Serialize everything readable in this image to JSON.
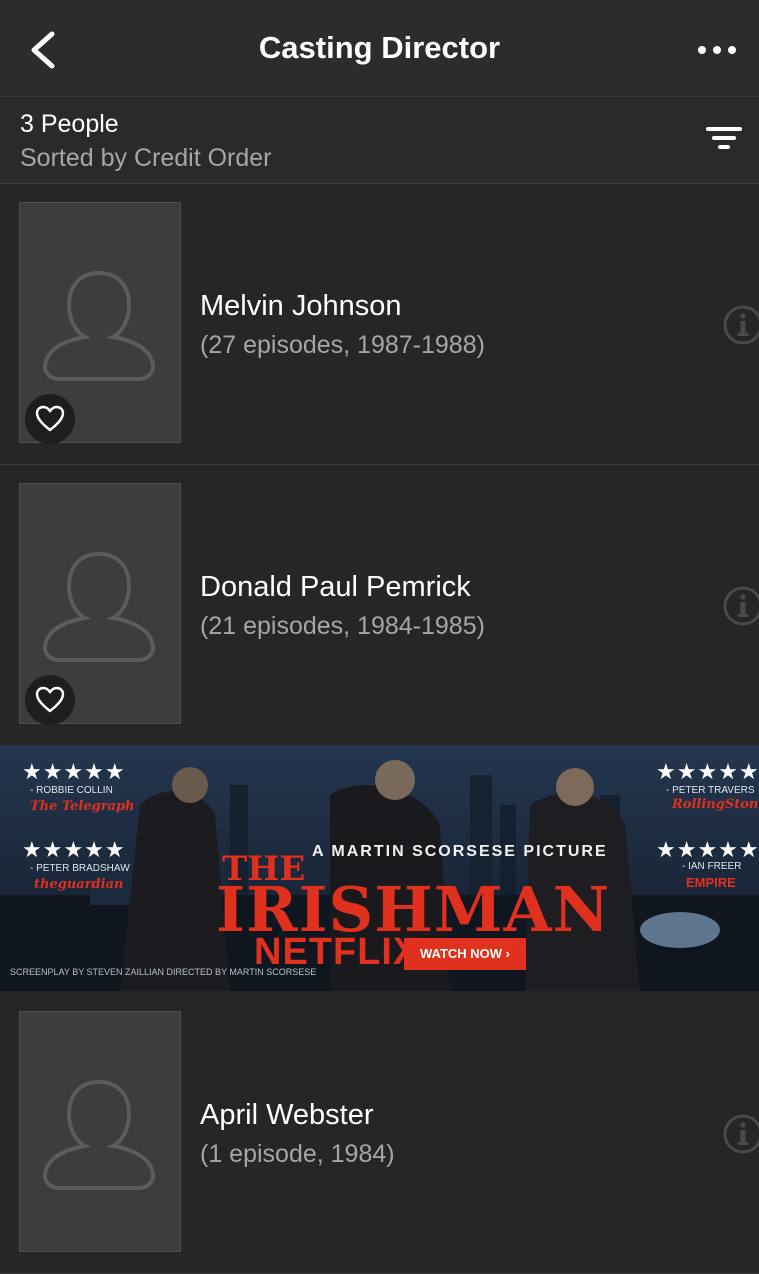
{
  "header": {
    "title": "Casting Director"
  },
  "summary": {
    "count": "3 People",
    "sort": "Sorted by Credit Order"
  },
  "people": [
    {
      "name": "Melvin Johnson",
      "episodes": "(27 episodes, 1987-1988)"
    },
    {
      "name": "Donald Paul Pemrick",
      "episodes": "(21 episodes, 1984-1985)"
    },
    {
      "name": "April Webster",
      "episodes": "(1 episode, 1984)"
    }
  ],
  "ad": {
    "stars": "★★★★★",
    "critics": [
      {
        "name": "- ROBBIE COLLIN",
        "outlet": "The Telegraph"
      },
      {
        "name": "- PETER BRADSHAW",
        "outlet": "theguardian"
      },
      {
        "name": "- PETER TRAVERS",
        "outlet": "RollingStone"
      },
      {
        "name": "- IAN FREER",
        "outlet": "EMPIRE"
      }
    ],
    "tagline": "A MARTIN SCORSESE PICTURE",
    "title_line1": "THE",
    "title_line2": "IRISHMAN",
    "brand": "NETFLIX",
    "cta": "WATCH NOW ›",
    "credits": "SCREENPLAY BY STEVEN ZAILLIAN  DIRECTED BY MARTIN SCORSESE",
    "brand_color": "#e0301e"
  }
}
